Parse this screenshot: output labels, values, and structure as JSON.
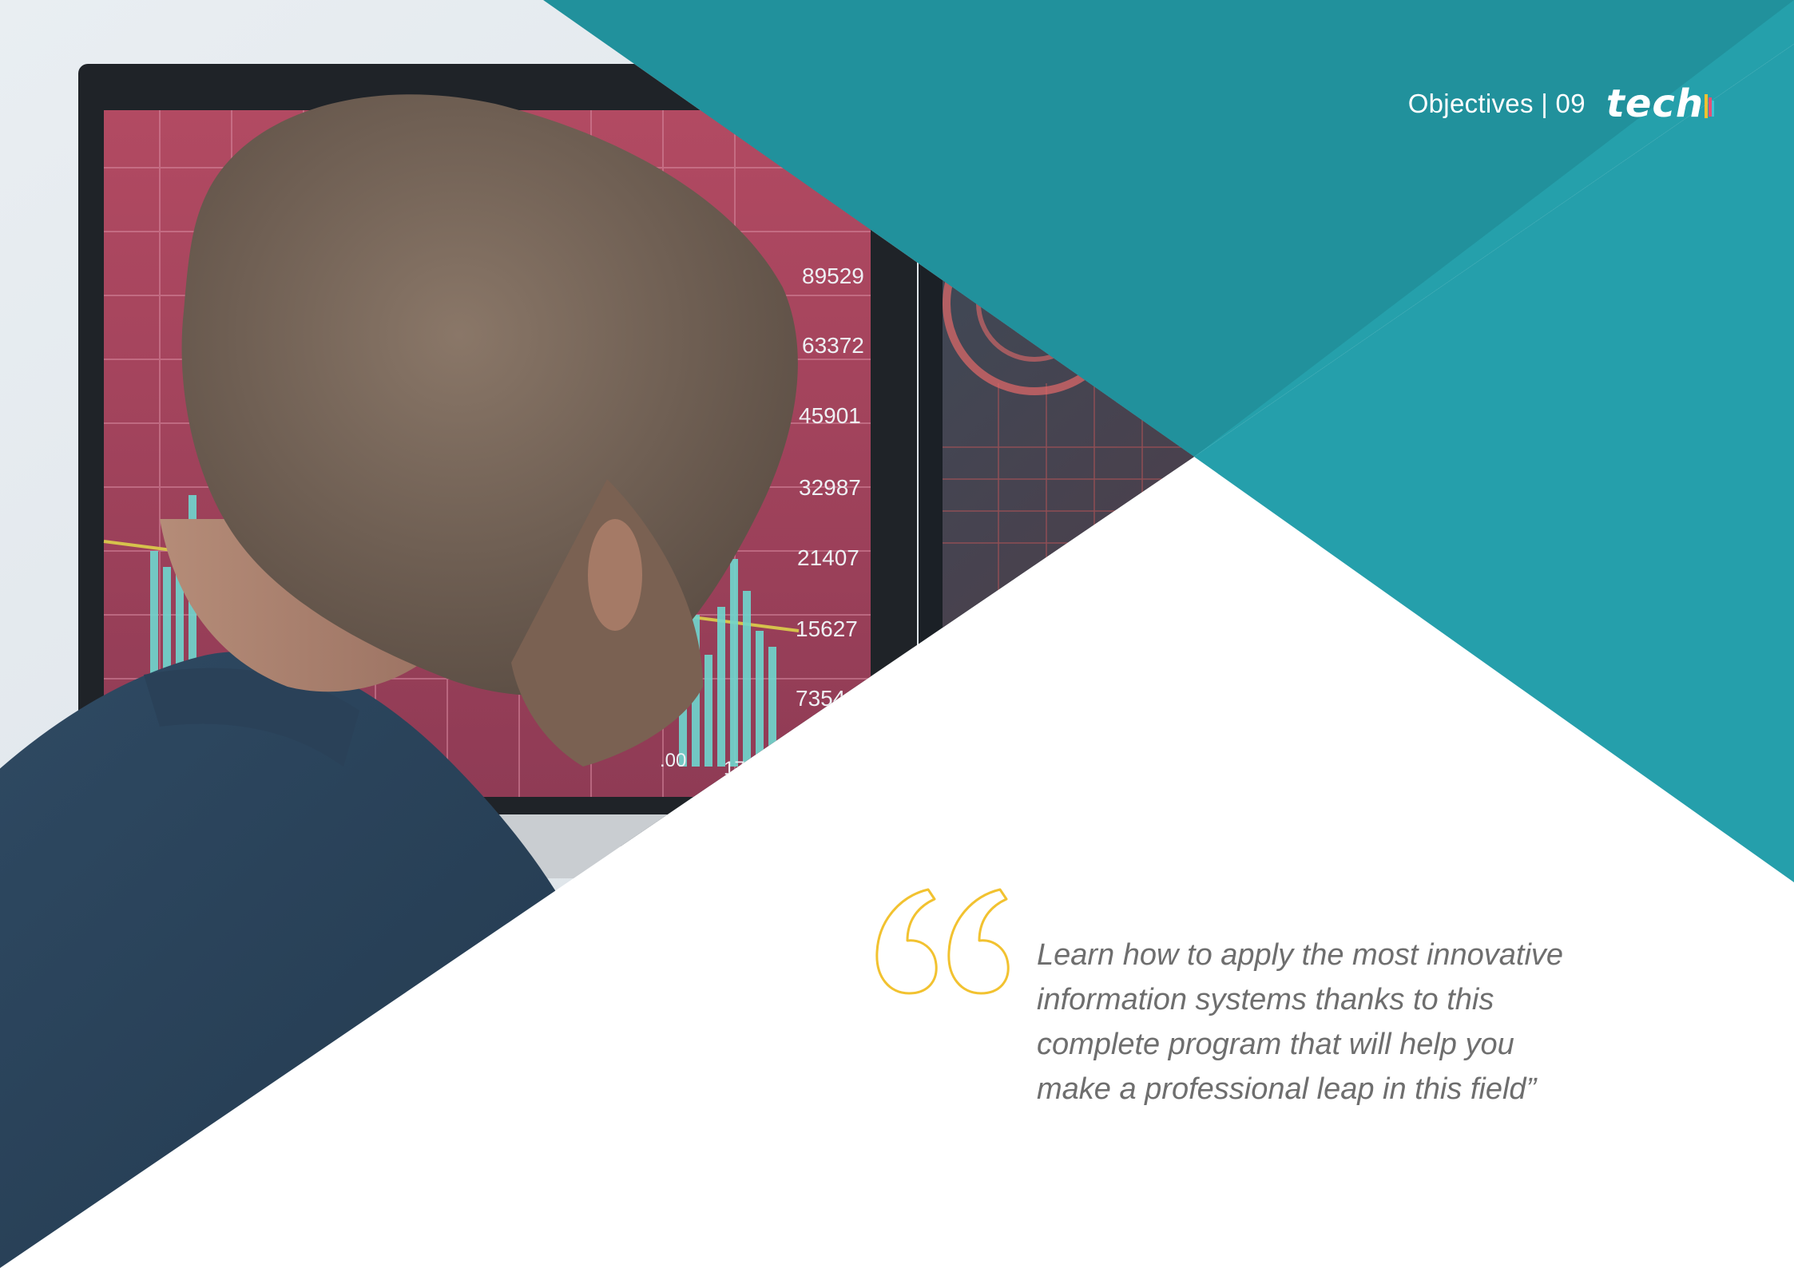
{
  "header": {
    "section": "Objectives | 09",
    "logo": "tech"
  },
  "photo": {
    "screen_values": [
      "89529",
      "63372",
      "45901",
      "32987",
      "21407",
      "15627",
      "7354"
    ],
    "axis_fragments": [
      ".00",
      "17"
    ]
  },
  "quote": {
    "icon": "quote-icon",
    "text": "Learn how to apply the most innovative information systems thanks to this complete program that will help you make a professional leap in this field”"
  },
  "colors": {
    "teal": "#25a0ab",
    "teal_dark": "#1c7f8a",
    "quote_yellow": "#f2c230",
    "text_gray": "#6e6e6e"
  }
}
